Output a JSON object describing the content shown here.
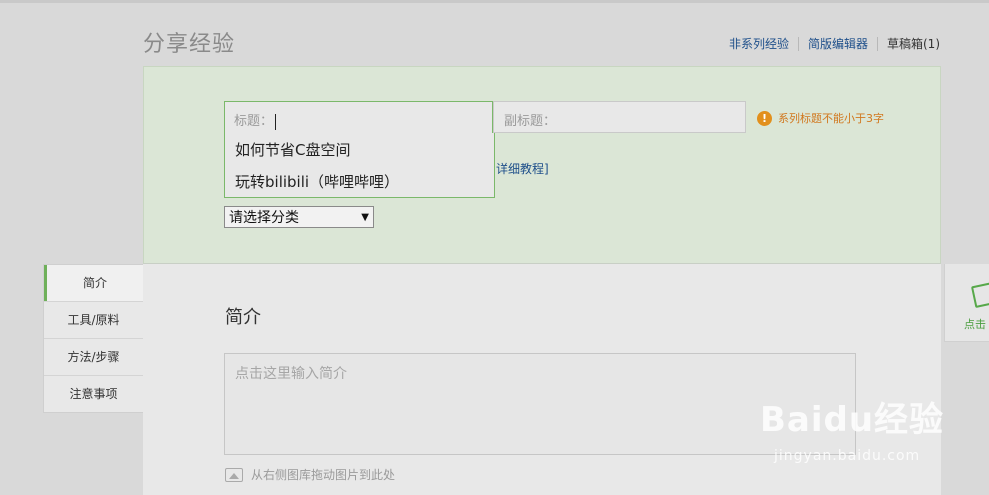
{
  "header": {
    "page_title": "分享经验",
    "links": [
      "非系列经验",
      "简版编辑器",
      "草稿箱(1)"
    ]
  },
  "title_form": {
    "title_placeholder": "标题：",
    "subtitle_placeholder": "副标题：",
    "warning_text": "系列标题不能小于3字",
    "tutorial_link": "详细教程]",
    "suggestions": [
      "如何节省C盘空间",
      "玩转bilibili（哔哩哔哩）"
    ],
    "category_selected": "请选择分类"
  },
  "side_nav": {
    "items": [
      "简介",
      "工具/原料",
      "方法/步骤",
      "注意事项"
    ]
  },
  "editor": {
    "section_title": "简介",
    "intro_placeholder": "点击这里输入简介",
    "drag_hint": "从右侧图库拖动图片到此处"
  },
  "right_panel": {
    "label": "点击"
  },
  "watermark": {
    "brand": "Baidu经验",
    "url": "jingyan.baidu.com"
  },
  "colors": {
    "accent_green": "#6fb05a",
    "link_blue": "#1e4f8a",
    "warning_orange": "#e2901d"
  }
}
